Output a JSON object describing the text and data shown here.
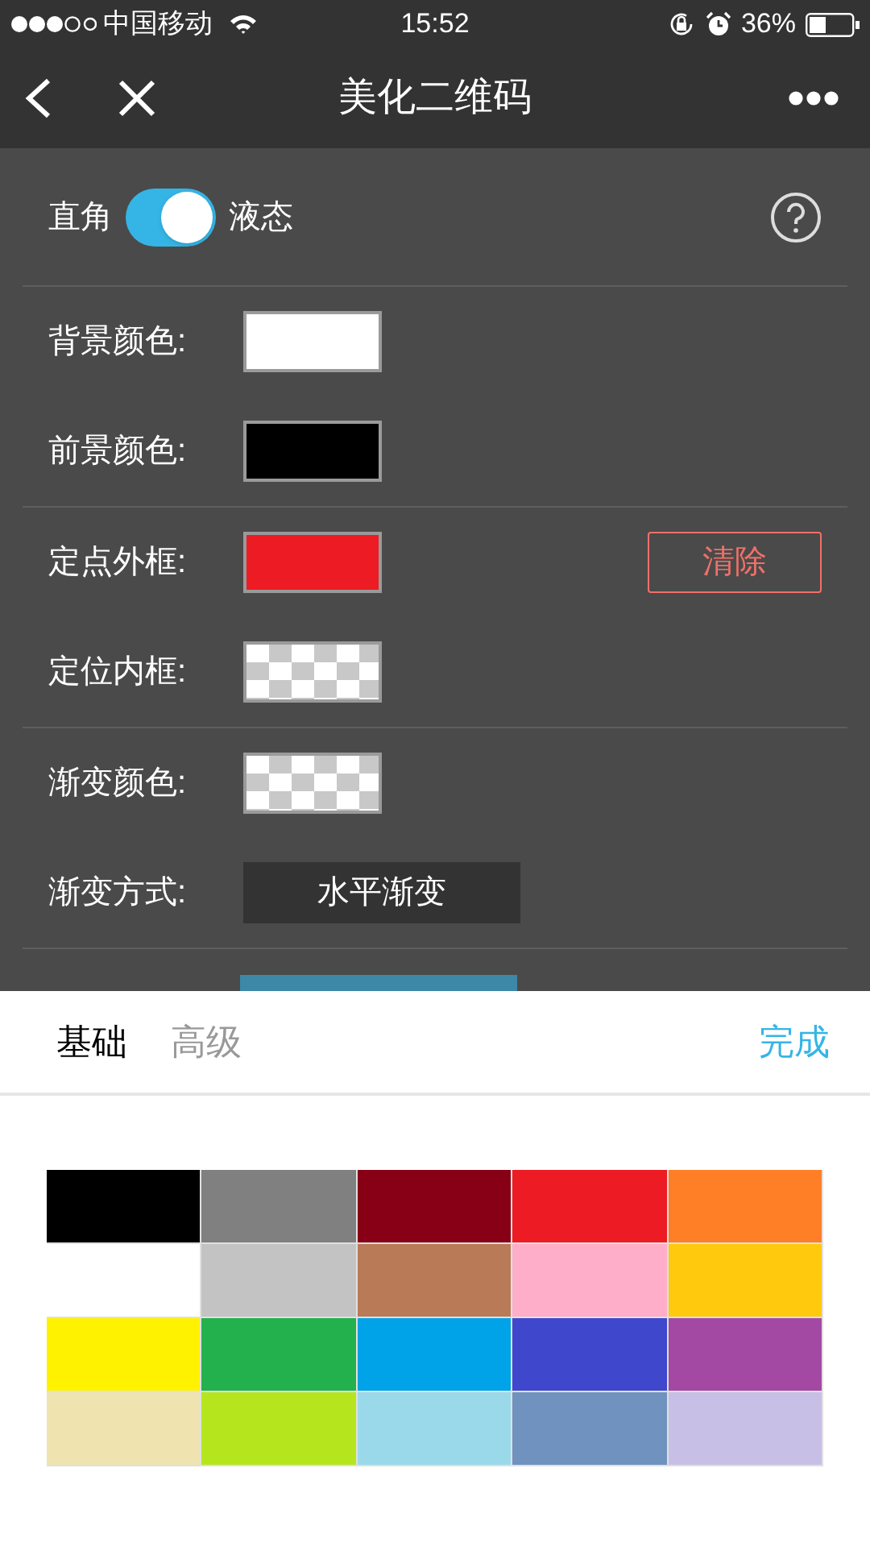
{
  "status_bar": {
    "carrier": "中国移动",
    "time": "15:52",
    "battery": "36%"
  },
  "nav": {
    "title": "美化二维码"
  },
  "style_toggle": {
    "left_label": "直角",
    "right_label": "液态",
    "on": true
  },
  "sections": [
    [
      {
        "kind": "color",
        "label": "背景颜色:",
        "color": "#ffffff"
      },
      {
        "kind": "color",
        "label": "前景颜色:",
        "color": "#000000"
      }
    ],
    [
      {
        "kind": "color",
        "label": "定点外框:",
        "color": "#ed1c24",
        "clear_button": "清除"
      },
      {
        "kind": "transparent",
        "label": "定位内框:"
      }
    ],
    [
      {
        "kind": "transparent",
        "label": "渐变颜色:"
      },
      {
        "kind": "select",
        "label": "渐变方式:",
        "value": "水平渐变"
      }
    ]
  ],
  "picker": {
    "tabs": [
      {
        "label": "基础",
        "selected": true
      },
      {
        "label": "高级",
        "selected": false
      }
    ],
    "done": "完成",
    "colors": [
      {
        "color": "#000000"
      },
      {
        "color": "#808080"
      },
      {
        "color": "#880015"
      },
      {
        "color": "#ed1c24"
      },
      {
        "color": "#ff7f27"
      },
      {
        "color": "#ffffff"
      },
      {
        "color": "#c3c3c3"
      },
      {
        "color": "#b97a57"
      },
      {
        "color": "#ffaec9"
      },
      {
        "color": "#ffc90e"
      },
      {
        "color": "#fff200"
      },
      {
        "color": "#22b14c"
      },
      {
        "color": "#00a2e8"
      },
      {
        "color": "#3f48cc"
      },
      {
        "color": "#a349a4"
      },
      {
        "color": "#efe4b0"
      },
      {
        "color": "#b5e61d"
      },
      {
        "color": "#99d9ea"
      },
      {
        "color": "#7092be"
      },
      {
        "color": "#c8bfe7"
      }
    ]
  }
}
